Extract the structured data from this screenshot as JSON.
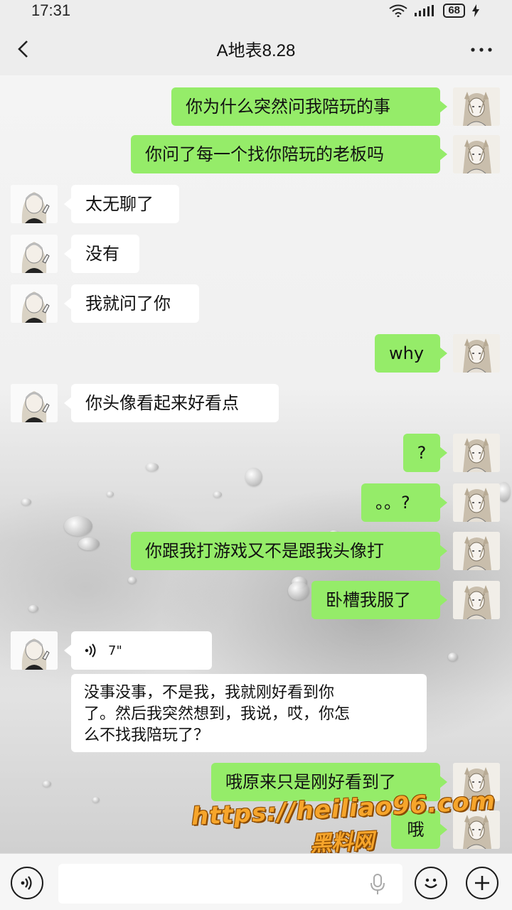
{
  "status_bar": {
    "time": "17:31",
    "battery": "68"
  },
  "header": {
    "title": "A地表8.28"
  },
  "messages": [
    {
      "side": "out",
      "text": "你为什么突然问我陪玩的事"
    },
    {
      "side": "out",
      "text": "你问了每一个找你陪玩的老板吗"
    },
    {
      "side": "in",
      "text": "太无聊了"
    },
    {
      "side": "in",
      "text": "没有"
    },
    {
      "side": "in",
      "text": "我就问了你"
    },
    {
      "side": "out",
      "text": "why"
    },
    {
      "side": "in",
      "text": "你头像看起来好看点"
    },
    {
      "side": "out",
      "text": "?"
    },
    {
      "side": "out",
      "text": "。。?"
    },
    {
      "side": "out",
      "text": "你跟我打游戏又不是跟我头像打"
    },
    {
      "side": "out",
      "text": "卧槽我服了"
    },
    {
      "side": "out",
      "text": "哦原来只是刚好看到了"
    },
    {
      "side": "out",
      "text": "哦"
    }
  ],
  "voice_message": {
    "duration": "7\"",
    "transcript_lines": [
      "没事没事，不是我，我就刚好看到你",
      "了。然后我突然想到，我说，哎，你怎",
      "么不找我陪玩了？"
    ]
  },
  "watermark": {
    "url": "https://heiliao96.com",
    "name": "黑料网",
    "color": "#f6a52b"
  },
  "input_bar": {
    "value": ""
  },
  "colors": {
    "outgoing_bubble": "#95ec69",
    "incoming_bubble": "#ffffff",
    "accent": "#f6a52b"
  }
}
